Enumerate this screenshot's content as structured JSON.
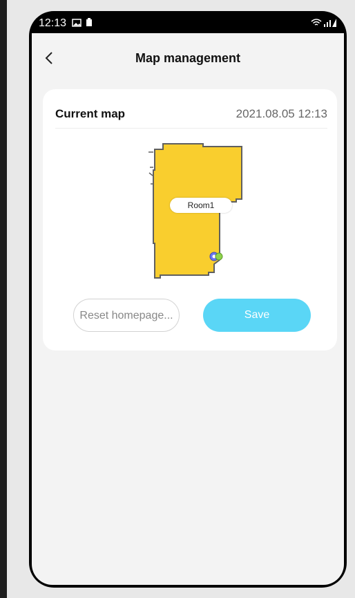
{
  "status_bar": {
    "time": "12:13",
    "icons": [
      "gallery-icon",
      "battery-saver-icon",
      "wifi-icon",
      "signal-icon"
    ]
  },
  "header": {
    "title": "Map management",
    "back_icon": "chevron-left-icon"
  },
  "card": {
    "label": "Current map",
    "date": "2021.08.05 12:13",
    "map": {
      "room_name": "Room1",
      "floor_color": "#f9ce2e",
      "border_color": "#5f5f5f",
      "dock_icon": "robot-dock-icon"
    },
    "buttons": {
      "reset_label": "Reset homepage...",
      "save_label": "Save",
      "save_color": "#5ad6f6"
    }
  }
}
